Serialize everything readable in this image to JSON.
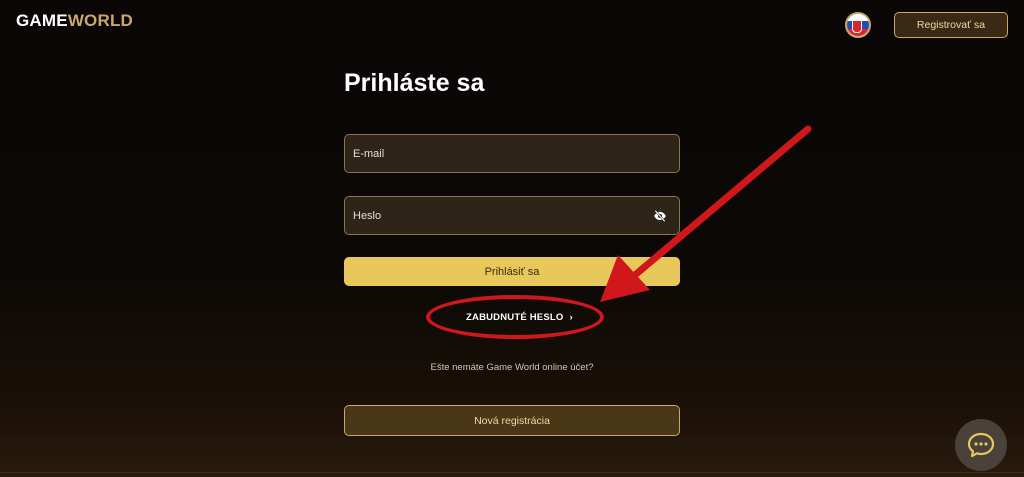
{
  "header": {
    "logo_part1": "GAME",
    "logo_part2": "WORLD",
    "register_label": "Registrovať sa"
  },
  "form": {
    "title": "Prihláste sa",
    "email_placeholder": "E-mail",
    "password_placeholder": "Heslo",
    "login_label": "Prihlásiť sa",
    "forgot_label": "ZABUDNUTÉ HESLO",
    "forgot_chevron": "›",
    "no_account_text": "Ešte nemáte Game World online účet?",
    "new_registration_label": "Nová registrácia"
  },
  "icons": {
    "language": "slovak-flag-icon",
    "password_toggle": "eye-slash-icon",
    "chat": "chat-bubble-icon"
  },
  "colors": {
    "accent_gold": "#c9a86a",
    "button_yellow": "#e8c85a",
    "highlight_red": "#d0181c"
  }
}
